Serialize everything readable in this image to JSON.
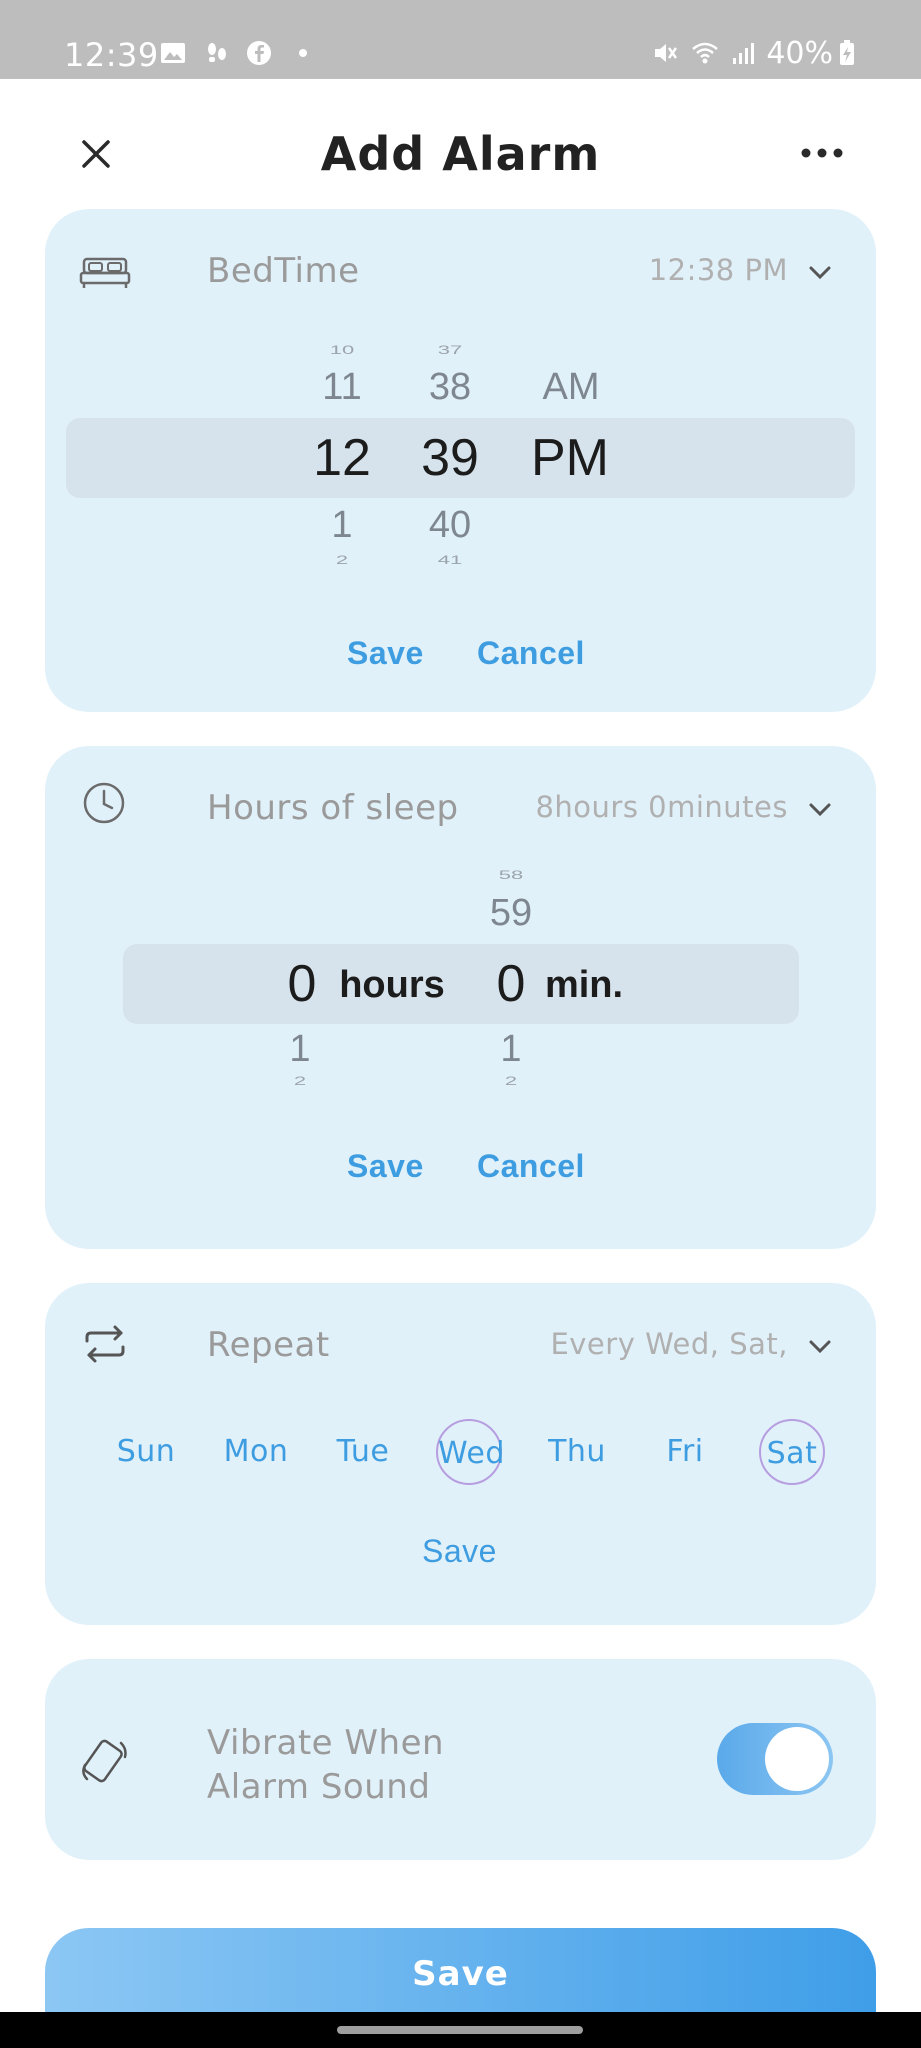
{
  "status_bar": {
    "time": "12:39",
    "battery": "40%",
    "icons": [
      "image-icon",
      "footsteps-icon",
      "facebook-icon",
      "dot-icon",
      "mute-icon",
      "wifi-icon",
      "signal-icon",
      "battery-charging-icon"
    ]
  },
  "header": {
    "title": "Add Alarm",
    "close_icon": "close-icon",
    "more_icon": "more-horizontal-icon"
  },
  "bedtime": {
    "title": "BedTime",
    "summary": "12:38 PM",
    "icon": "bed-icon",
    "hours": {
      "far_above": "10",
      "above": "11",
      "selected": "12",
      "below": "1",
      "far_below": "2"
    },
    "minutes": {
      "far_above": "37",
      "above": "38",
      "selected": "39",
      "below": "40",
      "far_below": "41"
    },
    "ampm": {
      "above": "AM",
      "selected": "PM"
    },
    "save_label": "Save",
    "cancel_label": "Cancel"
  },
  "sleep": {
    "title": "Hours of sleep",
    "summary": "8hours 0minutes",
    "icon": "clock-icon",
    "hours": {
      "selected": "0",
      "below": "1",
      "far_below": "2",
      "unit": "hours"
    },
    "minutes": {
      "far_above": "58",
      "above": "59",
      "selected": "0",
      "below": "1",
      "far_below": "2",
      "unit": "min."
    },
    "save_label": "Save",
    "cancel_label": "Cancel"
  },
  "repeat": {
    "title": "Repeat",
    "summary": "Every Wed, Sat,",
    "icon": "repeat-icon",
    "days": [
      {
        "label": "Sun",
        "selected": false
      },
      {
        "label": "Mon",
        "selected": false
      },
      {
        "label": "Tue",
        "selected": false
      },
      {
        "label": "Wed",
        "selected": true
      },
      {
        "label": "Thu",
        "selected": false
      },
      {
        "label": "Fri",
        "selected": false
      },
      {
        "label": "Sat",
        "selected": true
      }
    ],
    "save_label": "Save"
  },
  "vibrate": {
    "icon": "vibrate-icon",
    "line1": "Vibrate When",
    "line2": "Alarm Sound",
    "enabled": true
  },
  "main_save_label": "Save",
  "colors": {
    "card_bg": "#e1f1fa",
    "accent": "#3e9de0",
    "selection_band": "#d6e3ec",
    "day_ring": "#b69ee0"
  }
}
